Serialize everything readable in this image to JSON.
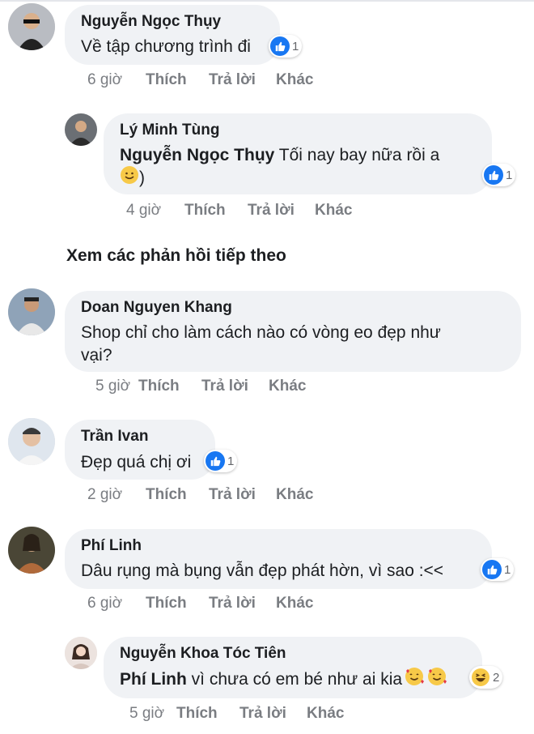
{
  "comments": [
    {
      "name": "Nguyễn Ngọc Thụy",
      "text": "Về tập chương trình đi",
      "reactions": "1",
      "time": "6 giờ",
      "like": "Thích",
      "reply": "Trả lời",
      "more": "Khác"
    },
    {
      "name": "Lý Minh Tùng",
      "mention": "Nguyễn Ngọc Thụy",
      "text_line1": " Tối nay bay nữa rồi a",
      "text_line2": ")",
      "reactions": "1",
      "time": "4 giờ",
      "like": "Thích",
      "reply": "Trả lời",
      "more": "Khác"
    },
    {
      "name": "Doan Nguyen Khang",
      "text_line1": "Shop chỉ cho làm cách nào có vòng eo đẹp như",
      "text_line2": "vại?",
      "time": "5 giờ",
      "like": "Thích",
      "reply": "Trả lời",
      "more": "Khác"
    },
    {
      "name": "Trần Ivan",
      "text": "Đẹp quá chị ơi",
      "reactions": "1",
      "time": "2 giờ",
      "like": "Thích",
      "reply": "Trả lời",
      "more": "Khác"
    },
    {
      "name": "Phí Linh",
      "text": "Dâu rụng mà bụng vẫn đẹp phát hờn, vì sao :<<",
      "reactions": "1",
      "time": "6 giờ",
      "like": "Thích",
      "reply": "Trả lời",
      "more": "Khác"
    },
    {
      "name": "Nguyễn Khoa Tóc Tiên",
      "mention": "Phí Linh",
      "text": " vì chưa có em bé như ai kia",
      "reactions": "2",
      "time": "5 giờ",
      "like": "Thích",
      "reply": "Trả lời",
      "more": "Khác"
    }
  ],
  "view_more_replies": "Xem các phản hồi tiếp theo",
  "colors": {
    "like_blue": "#1877f2",
    "bubble": "#f0f2f5",
    "meta": "#7a7d82"
  }
}
